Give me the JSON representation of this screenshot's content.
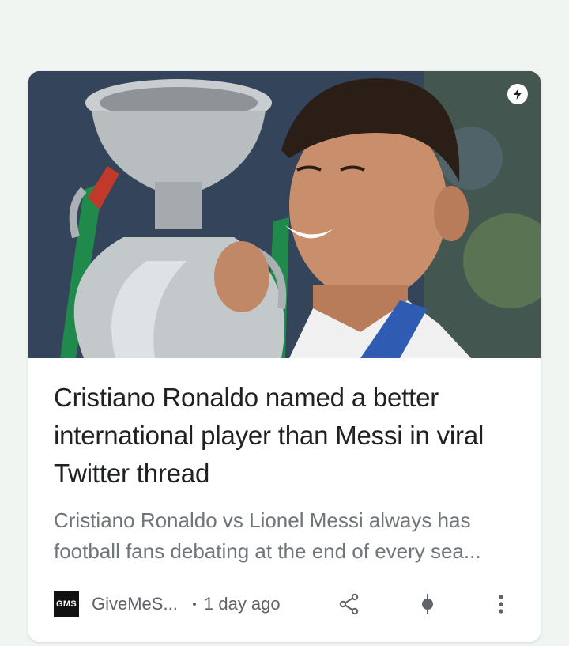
{
  "article": {
    "headline": "Cristiano Ronaldo named a better international player than Messi in viral Twitter thread",
    "snippet": "Cristiano Ronaldo vs Lionel Messi always has football fans debating at the end of every sea...",
    "source_logo_text": "GMS",
    "source_name": "GiveMeS...",
    "separator": "•",
    "time": "1 day ago"
  },
  "icons": {
    "amp": "lightning-bolt-icon",
    "share": "share-icon",
    "interest": "interest-dot-icon",
    "more": "more-vertical-icon"
  },
  "colors": {
    "background": "#f1f5f2",
    "card": "#ffffff",
    "headline": "#202124",
    "snippet": "#70757a",
    "meta": "#5f6368"
  }
}
